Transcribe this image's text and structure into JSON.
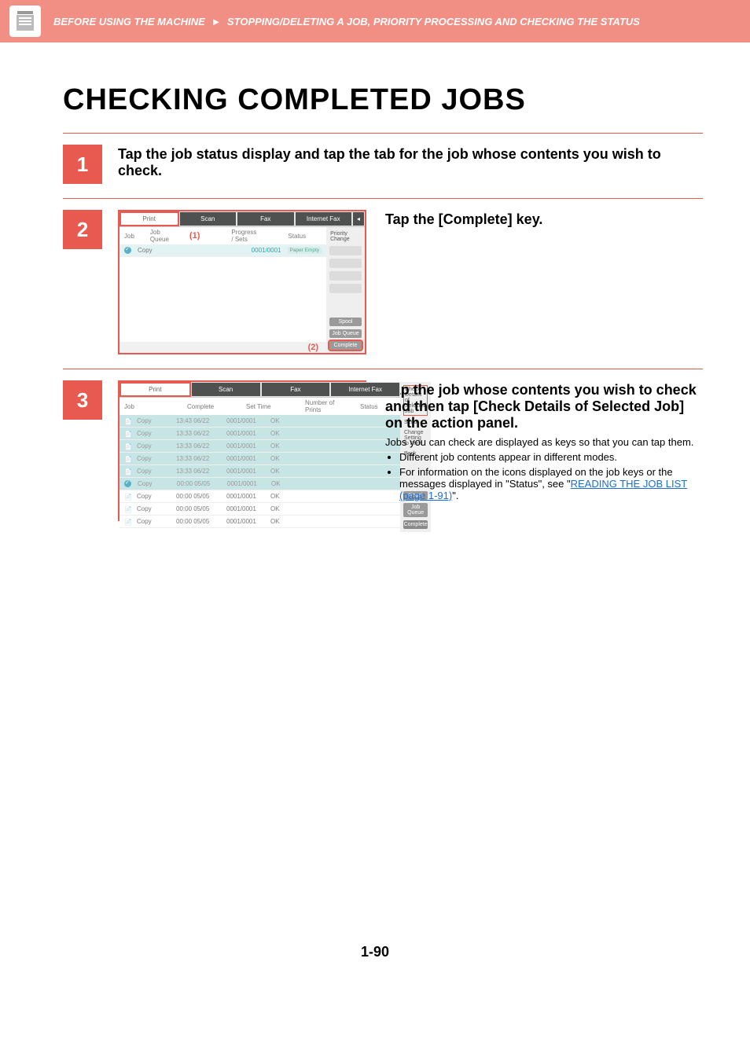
{
  "breadcrumb": {
    "part1": "BEFORE USING THE MACHINE",
    "part2": "STOPPING/DELETING A JOB, PRIORITY PROCESSING AND CHECKING THE STATUS"
  },
  "page_title": "CHECKING COMPLETED JOBS",
  "page_number": "1-90",
  "step1": {
    "num": "1",
    "title": "Tap the job status display and tap the tab for the job whose contents you wish to check."
  },
  "step2": {
    "num": "2",
    "title": "Tap the [Complete] key.",
    "annotations": {
      "a1": "(1)",
      "a2": "(2)"
    },
    "tabs": {
      "print": "Print",
      "scan": "Scan",
      "fax": "Fax",
      "ifax": "Internet Fax"
    },
    "headers": {
      "job": "Job",
      "queue": "Job Queue",
      "progress": "Progress / Sets",
      "status": "Status"
    },
    "row1": {
      "name": "Copy",
      "progress": "0001/0001",
      "status": "Paper Empty"
    },
    "side": {
      "priority": "Priority Change",
      "spool": "Spool",
      "jobqueue": "Job Queue",
      "complete": "Complete"
    }
  },
  "step3": {
    "num": "3",
    "title": "Tap the job whose contents you wish to check and then tap [Check Details of Selected Job] on the action panel.",
    "desc": "Jobs you can check are displayed as keys so that you can tap them.",
    "bullet1": "Different job contents appear in different modes.",
    "bullet2_pre": "For information on the icons displayed on the job keys or the messages displayed in \"Status\", see \"",
    "bullet2_link": "READING THE JOB LIST (page 1-91)",
    "bullet2_post": "\".",
    "tabs": {
      "print": "Print",
      "scan": "Scan",
      "fax": "Fax",
      "ifax": "Internet Fax"
    },
    "headers": {
      "job": "Job",
      "complete": "Complete",
      "settime": "Set Time",
      "numprints": "Number of Prints",
      "status": "Status"
    },
    "rows": [
      {
        "name": "Copy",
        "time": "13:43 06/22",
        "num": "0001/0001",
        "st": "OK",
        "hl": true
      },
      {
        "name": "Copy",
        "time": "13:33 06/22",
        "num": "0001/0001",
        "st": "OK",
        "hl": true
      },
      {
        "name": "Copy",
        "time": "13:33 06/22",
        "num": "0001/0001",
        "st": "OK",
        "hl": true
      },
      {
        "name": "Copy",
        "time": "13:33 06/22",
        "num": "0001/0001",
        "st": "OK",
        "hl": true
      },
      {
        "name": "Copy",
        "time": "13:33 06/22",
        "num": "0001/0001",
        "st": "OK",
        "hl": true
      },
      {
        "name": "Copy",
        "time": "00:00 05/05",
        "num": "0001/0001",
        "st": "OK",
        "hl": true,
        "sel": true
      },
      {
        "name": "Copy",
        "time": "00:00 05/05",
        "num": "0001/0001",
        "st": "OK"
      },
      {
        "name": "Copy",
        "time": "00:00 05/05",
        "num": "0001/0001",
        "st": "OK"
      },
      {
        "name": "Copy",
        "time": "00:00 05/05",
        "num": "0001/0001",
        "st": "OK"
      }
    ],
    "side": {
      "check": "Check Details of\nSelected Job",
      "send": "Send",
      "change": "Change Setting to Print",
      "back": "Back",
      "spool": "Spool",
      "jobqueue": "Job Queue",
      "complete": "Complete"
    }
  }
}
